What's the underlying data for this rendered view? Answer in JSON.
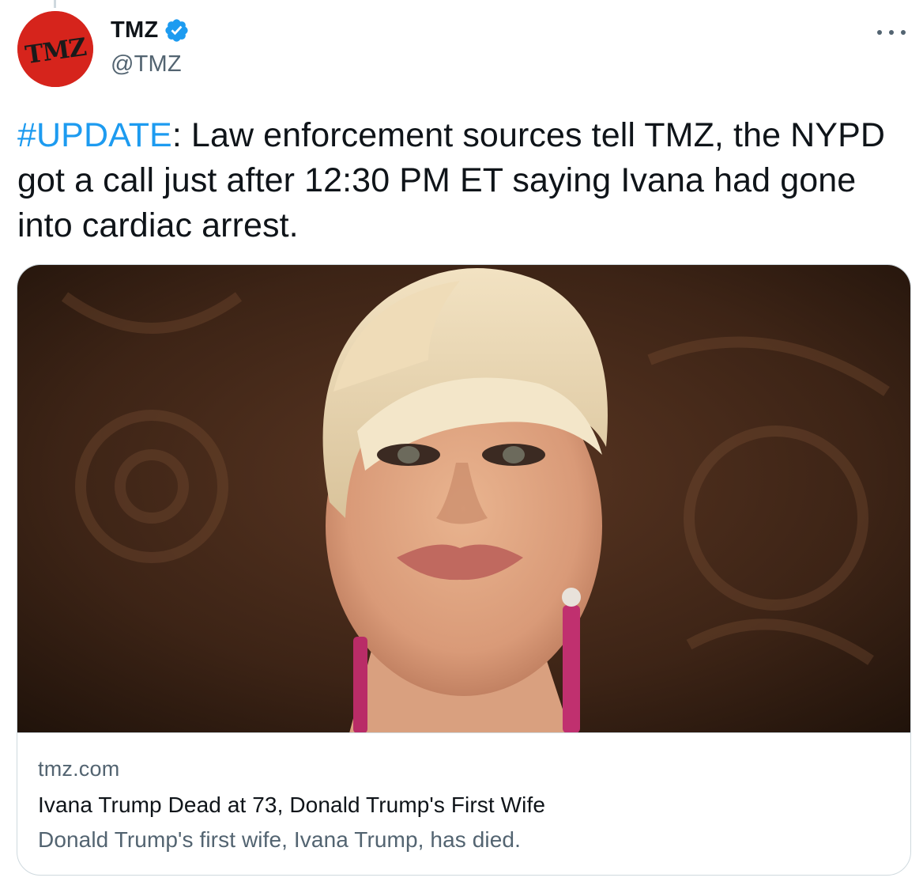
{
  "author": {
    "display_name": "TMZ",
    "handle": "@TMZ",
    "avatar_text": "TMZ",
    "verified": true
  },
  "tweet": {
    "hashtag": "#UPDATE",
    "text": ": Law enforcement sources tell TMZ, the NYPD got a call just after 12:30 PM ET saying Ivana had gone into cardiac arrest."
  },
  "card": {
    "domain": "tmz.com",
    "title": "Ivana Trump Dead at 73, Donald Trump's First Wife",
    "description": "Donald Trump's first wife, Ivana Trump, has died."
  },
  "icons": {
    "more": "more-horizontal-icon",
    "verified": "verified-badge-icon"
  },
  "colors": {
    "accent": "#1d9bf0",
    "avatar_bg": "#d6241c",
    "secondary_text": "#536471",
    "border": "#cfd9de"
  }
}
